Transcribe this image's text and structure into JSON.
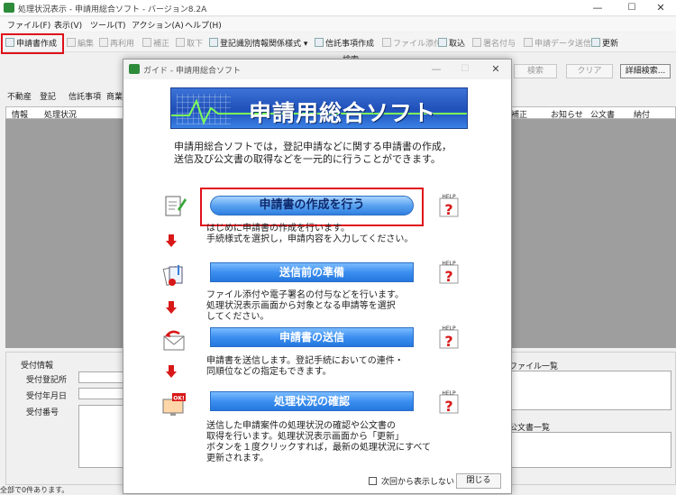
{
  "window": {
    "title": "処理状況表示 - 申請用総合ソフト - バージョン8.2A",
    "minimize": "—",
    "maximize": "☐",
    "close": "✕"
  },
  "menu": [
    "ファイル(F)",
    "表示(V)",
    "ツール(T)",
    "アクション(A)",
    "ヘルプ(H)"
  ],
  "toolbar": {
    "create": "申請書作成",
    "edit": "編集",
    "reuse": "再利用",
    "amend": "補正",
    "withdraw": "取下",
    "registry_info": "登記識別情報関係様式 ▾",
    "trust_create": "信託事項作成",
    "attach": "ファイル添付",
    "fetch": "取込",
    "sign": "署名付与",
    "send": "申請データ送信",
    "refresh": "更新"
  },
  "search": {
    "title": "検索",
    "search_btn": "検索",
    "clear_btn": "クリア",
    "detail_btn": "詳細検索..."
  },
  "list_tabs": [
    "不動産",
    "登記",
    "信託事項",
    "商業"
  ],
  "list_headers_left": [
    "情報",
    "処理状況"
  ],
  "list_headers_right": [
    "補正",
    "お知らせ",
    "公文書",
    "納付"
  ],
  "bottom": {
    "section": "受付情報",
    "receipt_office": "受付登記所",
    "receipt_date": "受付年月日",
    "receipt_number": "受付番号",
    "file_list": "ファイル一覧",
    "official_list": "公文書一覧"
  },
  "status": "全部で0件あります。",
  "dialog": {
    "title": "ガイド - 申請用総合ソフト",
    "minimize": "—",
    "maximize": "☐",
    "close": "✕",
    "banner": "申請用総合ソフト",
    "intro_line1": "申請用総合ソフトでは，登記申請などに関する申請書の作成，",
    "intro_line2": "送信及び公文書の取得などを一元的に行うことができます。",
    "steps": [
      {
        "label": "申請書の作成を行う",
        "desc1": "はじめに申請書の作成を行います。",
        "desc2": "手続様式を選択し，申請内容を入力してください。"
      },
      {
        "label": "送信前の準備",
        "desc1": "ファイル添付や電子署名の付与などを行います。",
        "desc2": "処理状況表示画面から対象となる申請等を選択",
        "desc3": "してください。"
      },
      {
        "label": "申請書の送信",
        "desc1": "申請書を送信します。登記手続においての連件・",
        "desc2": "同順位などの指定もできます。"
      },
      {
        "label": "処理状況の確認",
        "desc1": "送信した申請案件の処理状況の確認や公文書の",
        "desc2": "取得を行います。処理状況表示画面から「更新」",
        "desc3": "ボタンを１度クリックすれば，最新の処理状況にすべて",
        "desc4": "更新されます。"
      }
    ],
    "help_label": "HELP",
    "help_mark": "?",
    "ok_label": "OK!",
    "dont_show": "次回から表示しない",
    "close_button": "閉じる"
  }
}
